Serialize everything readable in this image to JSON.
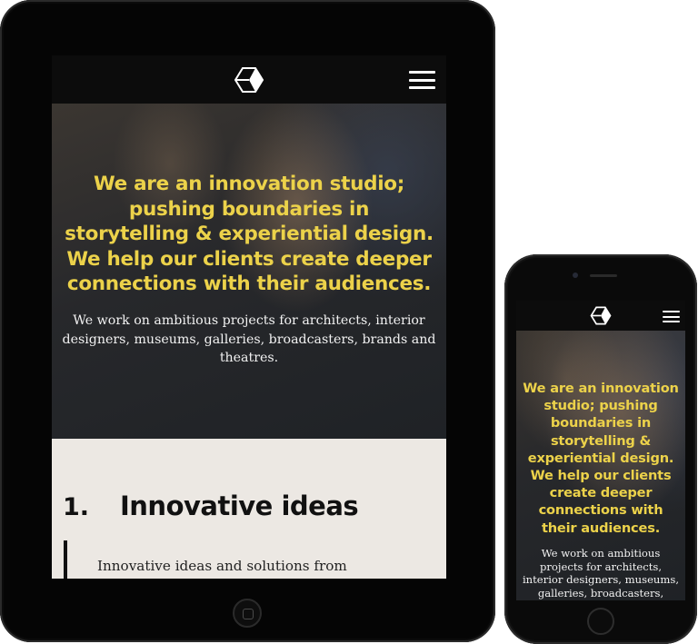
{
  "tablet": {
    "hero": {
      "title": "We are an innovation studio; pushing boundaries in storytelling & experiential design. We help our clients create deeper connections with their audiences.",
      "subtitle": "We work on ambitious projects for architects, interior designers, museums, galleries, broadcasters, brands and theatres."
    },
    "feature": {
      "number": "1.",
      "title": "Innovative ideas",
      "text": "Innovative ideas and solutions from creative thought, to installation"
    }
  },
  "phone": {
    "hero": {
      "title": "We are an innovation studio; pushing boundaries in storytelling & experiential design. We help our clients create deeper connections with their audiences.",
      "subtitle": "We work on ambitious projects for architects, interior designers, museums, galleries, broadcasters, brands and theatres."
    }
  },
  "colors": {
    "accent": "#ecd24a",
    "nav_background": "#0c0c0c",
    "section_background": "#ece8e3"
  },
  "icons": {
    "logo": "cube-logo-icon",
    "menu": "hamburger-menu-icon",
    "home_button": "home-button-icon"
  }
}
